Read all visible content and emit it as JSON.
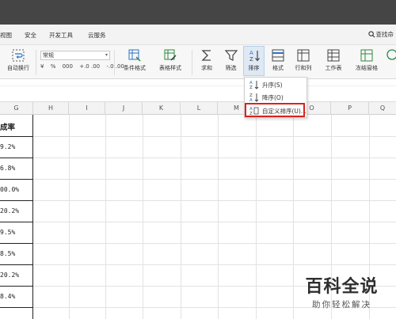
{
  "menu": {
    "items": [
      "视图",
      "安全",
      "开发工具",
      "云服务"
    ],
    "search_label": "查找命"
  },
  "ribbon": {
    "autowrap": "自动换行",
    "number_format": "常规",
    "number_buttons": [
      "¥",
      "%",
      "000",
      "+.0 .00",
      "-.0 .00"
    ],
    "conditional_format": "条件格式",
    "table_style": "表格样式",
    "sum": "求和",
    "filter": "筛选",
    "sort": "排序",
    "format": "格式",
    "rows_cols": "行和列",
    "worksheet": "工作表",
    "freeze": "冻结窗格"
  },
  "columns": [
    "G",
    "H",
    "I",
    "J",
    "K",
    "L",
    "M",
    "N",
    "O",
    "P",
    "Q"
  ],
  "g_column": {
    "header": "成率",
    "values": [
      "9.2%",
      "6.8%",
      "00.0%",
      "20.2%",
      "9.5%",
      "8.5%",
      "20.2%",
      "8.4%"
    ]
  },
  "sort_menu": {
    "items": [
      {
        "label": "升序(S)"
      },
      {
        "label": "降序(O)"
      },
      {
        "label": "自定义排序(U)..."
      }
    ]
  },
  "watermark": {
    "title": "百科全说",
    "subtitle": "助你轻松解决"
  },
  "colors": {
    "accent_blue": "#2b73c4",
    "highlight_red": "#d7241c",
    "titlebar": "#454545"
  }
}
